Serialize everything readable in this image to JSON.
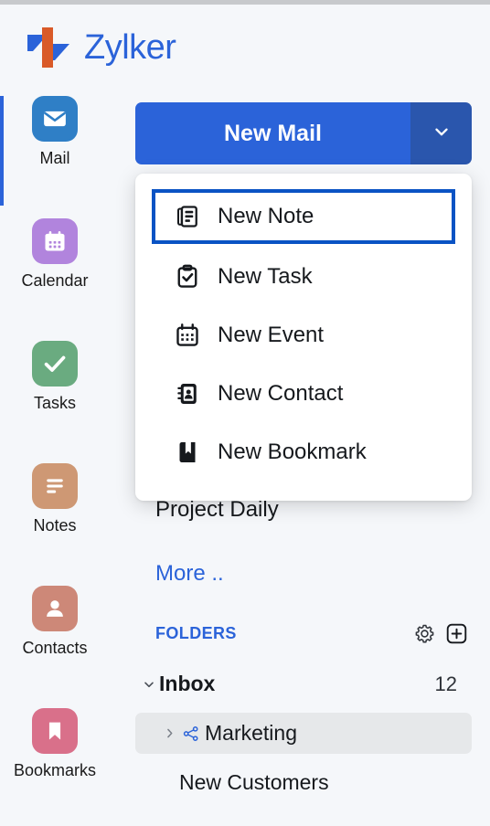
{
  "brand": {
    "name": "Zylker",
    "logo_icon": "zylker-logo",
    "logo_colors": {
      "blue": "#2b63d9",
      "orange": "#d95a28"
    }
  },
  "colors": {
    "accent_blue": "#2b63d9",
    "focus_blue": "#0a53c4",
    "button_blue": "#2b63d9",
    "button_blue_dark": "#2a56ad",
    "page_bg": "#f5f7fa",
    "hover_bg": "#e6e8ea",
    "text": "#16191d"
  },
  "app_rail": {
    "active_item": "Mail",
    "items": [
      {
        "label": "Mail",
        "icon": "envelope-icon",
        "color": "#2f7fc6"
      },
      {
        "label": "Calendar",
        "icon": "calendar-icon",
        "color": "#b184dd"
      },
      {
        "label": "Tasks",
        "icon": "check-icon",
        "color": "#6aab80"
      },
      {
        "label": "Notes",
        "icon": "notes-icon",
        "color": "#ce9874"
      },
      {
        "label": "Contacts",
        "icon": "contact-icon",
        "color": "#cd8878"
      },
      {
        "label": "Bookmarks",
        "icon": "bookmark-icon",
        "color": "#d9708a"
      }
    ]
  },
  "compose": {
    "label": "New Mail",
    "toggle_icon": "chevron-down-icon"
  },
  "compose_menu": {
    "focused_item": "New Note",
    "items": [
      {
        "label": "New Note",
        "icon": "note-icon"
      },
      {
        "label": "New Task",
        "icon": "clipboard-check-icon"
      },
      {
        "label": "New Event",
        "icon": "calendar-icon"
      },
      {
        "label": "New Contact",
        "icon": "address-book-icon"
      },
      {
        "label": "New Bookmark",
        "icon": "bookmark-book-icon"
      }
    ]
  },
  "behind_list": {
    "project_daily": "Project Daily",
    "more_link": "More .."
  },
  "folders": {
    "title": "FOLDERS",
    "settings_icon": "gear-icon",
    "add_icon": "plus-square-icon",
    "items": [
      {
        "name": "Inbox",
        "count": "12",
        "expanded": true,
        "shared": false,
        "hovered": false
      },
      {
        "name": "Marketing",
        "count": "",
        "expanded": false,
        "shared": true,
        "hovered": true
      },
      {
        "name": "New Customers",
        "count": "",
        "expanded": null,
        "shared": false,
        "hovered": false
      }
    ]
  }
}
